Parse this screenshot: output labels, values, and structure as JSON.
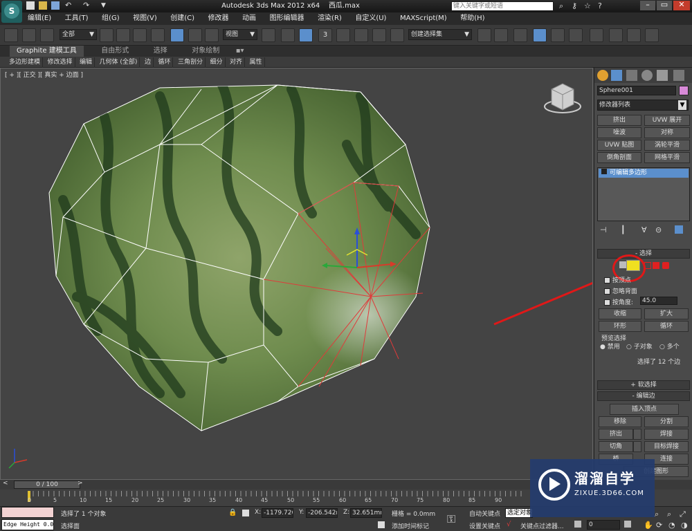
{
  "title": {
    "app": "Autodesk 3ds Max  2012 x64",
    "file": "西瓜.max",
    "search_placeholder": "键入关键字或短语"
  },
  "menu": [
    "编辑(E)",
    "工具(T)",
    "组(G)",
    "视图(V)",
    "创建(C)",
    "修改器",
    "动画",
    "图形编辑器",
    "渲染(R)",
    "自定义(U)",
    "MAXScript(M)",
    "帮助(H)"
  ],
  "toolbar": {
    "filter": "全部",
    "refcoord": "视图",
    "selset": "创建选择集",
    "snap_label": "3"
  },
  "ribbon": {
    "tabs": [
      "Graphite 建模工具",
      "自由形式",
      "选择",
      "对象绘制"
    ],
    "items": [
      "多边形建模",
      "修改选择",
      "编辑",
      "几何体 (全部)",
      "边",
      "循环",
      "三角剖分",
      "细分",
      "对齐",
      "属性"
    ]
  },
  "viewport": {
    "label": "[ + ][ 正交 ][ 真实 + 边面 ]"
  },
  "panel": {
    "object_name": "Sphere001",
    "modifier_list": "修改器列表",
    "mod_buttons": [
      "挤出",
      "UVW 展开",
      "噪波",
      "对称",
      "UVW 贴图",
      "涡轮平滑",
      "倒角剖面",
      "网格平滑"
    ],
    "stack_item": "可编辑多边形",
    "selection_title": "选择",
    "by_vertex": "按顶点",
    "ignore_backface": "忽略背面",
    "by_angle": "按角度:",
    "angle_value": "45.0",
    "shrink": "收缩",
    "grow": "扩大",
    "ring": "环形",
    "loop": "循环",
    "preview_title": "预览选择",
    "preview_off": "禁用",
    "preview_sub": "子对象",
    "preview_multi": "多个",
    "selected_info": "选择了 12 个边",
    "soft_sel": "软选择",
    "edit_edges": "编辑边",
    "insert_vertex": "插入顶点",
    "remove": "移除",
    "split": "分割",
    "extrude": "挤出",
    "weld": "焊接",
    "chamfer": "切角",
    "target_weld": "目标焊接",
    "bridge": "桥",
    "connect": "连接",
    "create_shape": "创建图形"
  },
  "timeline": {
    "frame": "0 / 100",
    "ticks": [
      "0",
      "5",
      "10",
      "15",
      "20",
      "25",
      "30",
      "35",
      "40",
      "45",
      "50",
      "55",
      "60",
      "65",
      "70",
      "75",
      "80",
      "85",
      "90"
    ]
  },
  "status": {
    "script": "Edge Height 0.0",
    "msg1": "选择了 1 个对象",
    "msg2": "选择面",
    "x": "-1179.726",
    "y": "-206.542m",
    "z": "32.651mm",
    "grid": "栅格 = 0.0mm",
    "autokey": "自动关键点",
    "selected": "选定对象",
    "setkey": "设置关键点",
    "keyfilter": "关键点过滤器...",
    "addtime": "添加时间标记",
    "frame_field": "0"
  },
  "watermark": {
    "site": "ZIXUE.3D66.COM"
  }
}
